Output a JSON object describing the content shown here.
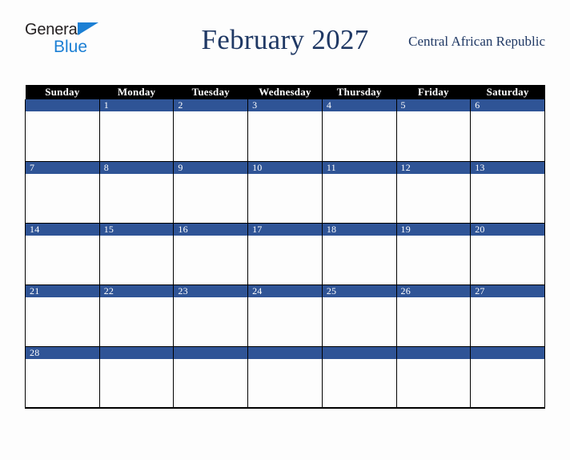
{
  "logo": {
    "text_top": "General",
    "text_bottom": "Blue",
    "triangle_color": "#1b7fd4",
    "top_color": "#231f20"
  },
  "header": {
    "title": "February 2027",
    "country": "Central African Republic",
    "title_color": "#1f3864"
  },
  "calendar": {
    "weekday_headers": [
      "Sunday",
      "Monday",
      "Tuesday",
      "Wednesday",
      "Thursday",
      "Friday",
      "Saturday"
    ],
    "header_bg": "#000000",
    "header_text_color": "#ffffff",
    "date_band_color": "#2f5496",
    "date_text_color": "#ffffff",
    "cell_bg": "#fdfdfd",
    "grid_line_color": "#000000",
    "weeks": [
      [
        "",
        "1",
        "2",
        "3",
        "4",
        "5",
        "6"
      ],
      [
        "7",
        "8",
        "9",
        "10",
        "11",
        "12",
        "13"
      ],
      [
        "14",
        "15",
        "16",
        "17",
        "18",
        "19",
        "20"
      ],
      [
        "21",
        "22",
        "23",
        "24",
        "25",
        "26",
        "27"
      ],
      [
        "28",
        "",
        "",
        "",
        "",
        "",
        ""
      ]
    ]
  }
}
